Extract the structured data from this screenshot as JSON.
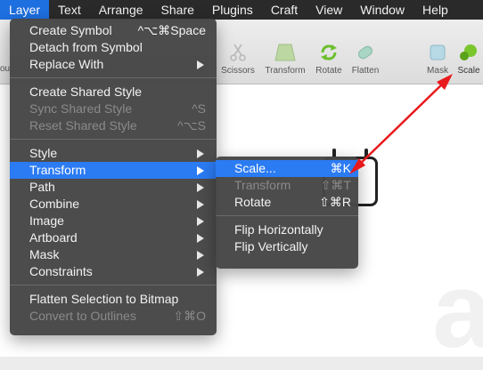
{
  "menubar": {
    "items": [
      "Layer",
      "Text",
      "Arrange",
      "Share",
      "Plugins",
      "Craft",
      "View",
      "Window",
      "Help"
    ],
    "active_index": 0
  },
  "toolbar": {
    "tools": [
      {
        "label": "Scissors",
        "icon": "scissors-icon"
      },
      {
        "label": "Transform",
        "icon": "transform-icon"
      },
      {
        "label": "Rotate",
        "icon": "rotate-icon"
      },
      {
        "label": "Flatten",
        "icon": "flatten-icon"
      },
      {
        "label": "Mask",
        "icon": "mask-icon"
      },
      {
        "label": "Scale",
        "icon": "scale-icon"
      }
    ],
    "partial_left_label": "ou"
  },
  "layer_menu": {
    "items": [
      {
        "label": "Create Symbol",
        "shortcut": "^⌥⌘Space"
      },
      {
        "label": "Detach from Symbol",
        "shortcut": ""
      },
      {
        "label": "Replace With",
        "shortcut": ""
      },
      {
        "label": "Create Shared Style",
        "shortcut": ""
      },
      {
        "label": "Sync Shared Style",
        "shortcut": "^S"
      },
      {
        "label": "Reset Shared Style",
        "shortcut": "^⌥S"
      },
      {
        "label": "Style",
        "shortcut": ""
      },
      {
        "label": "Transform",
        "shortcut": ""
      },
      {
        "label": "Path",
        "shortcut": ""
      },
      {
        "label": "Combine",
        "shortcut": ""
      },
      {
        "label": "Image",
        "shortcut": ""
      },
      {
        "label": "Artboard",
        "shortcut": ""
      },
      {
        "label": "Mask",
        "shortcut": ""
      },
      {
        "label": "Constraints",
        "shortcut": ""
      },
      {
        "label": "Flatten Selection to Bitmap",
        "shortcut": ""
      },
      {
        "label": "Convert to Outlines",
        "shortcut": "⇧⌘O"
      }
    ]
  },
  "transform_submenu": {
    "items": [
      {
        "label": "Scale...",
        "shortcut": "⌘K"
      },
      {
        "label": "Transform",
        "shortcut": "⇧⌘T"
      },
      {
        "label": "Rotate",
        "shortcut": "⇧⌘R"
      },
      {
        "label": "Flip Horizontally",
        "shortcut": ""
      },
      {
        "label": "Flip Vertically",
        "shortcut": ""
      }
    ]
  },
  "colors": {
    "menu_highlight": "#2b7bf3",
    "annotation_arrow": "#e8191c",
    "scale_icon": "#7bc62d"
  }
}
